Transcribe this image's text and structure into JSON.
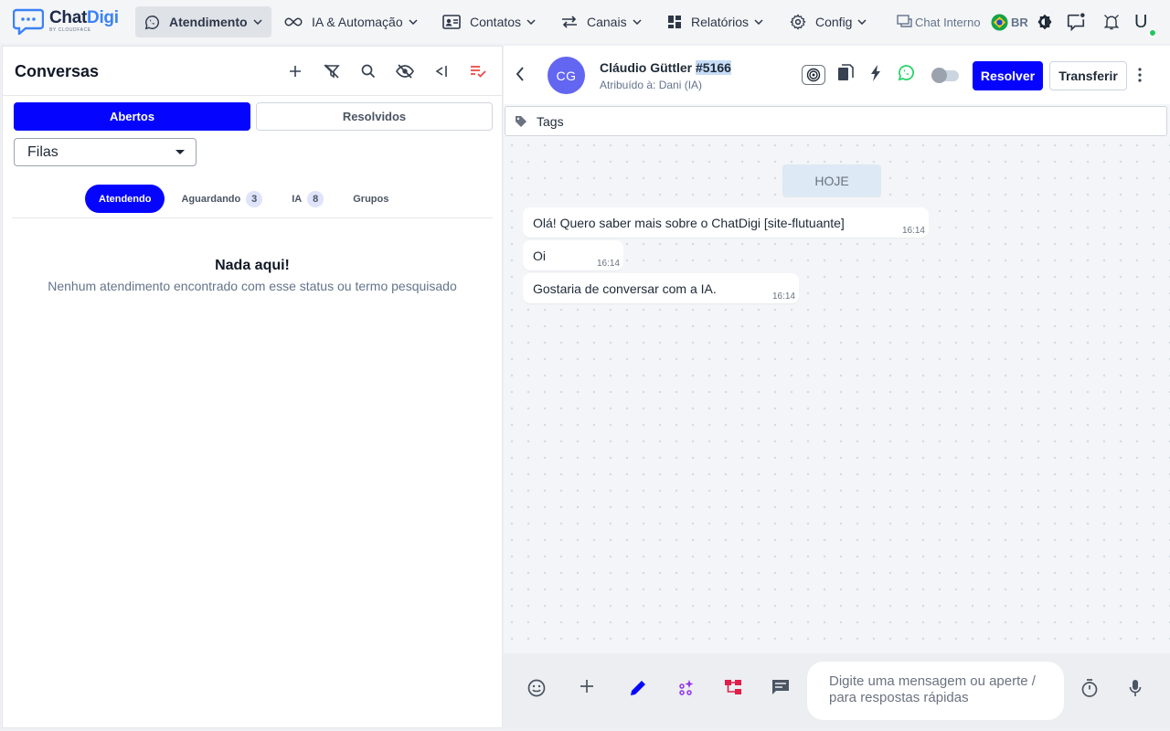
{
  "brand": {
    "name_main": "Chat",
    "name_accent": "Digi",
    "subtitle": "BY CLOUDFACE",
    "accent_color": "#3b82f6"
  },
  "nav": {
    "items": [
      {
        "label": "Atendimento",
        "icon": "whatsapp-icon",
        "active": true
      },
      {
        "label": "IA & Automação",
        "icon": "infinity-icon"
      },
      {
        "label": "Contatos",
        "icon": "contact-card-icon"
      },
      {
        "label": "Canais",
        "icon": "arrows-icon"
      },
      {
        "label": "Relatórios",
        "icon": "dashboard-icon"
      },
      {
        "label": "Config",
        "icon": "gear-icon"
      }
    ],
    "chat_interno": "Chat Interno",
    "lang": "BR",
    "user_initial": "U"
  },
  "left": {
    "title": "Conversas",
    "tabs": {
      "open": "Abertos",
      "resolved": "Resolvidos"
    },
    "queue_select": "Filas",
    "subtabs": [
      {
        "label": "Atendendo",
        "count": null
      },
      {
        "label": "Aguardando",
        "count": "3"
      },
      {
        "label": "IA",
        "count": "8"
      },
      {
        "label": "Grupos",
        "count": null
      }
    ],
    "empty_title": "Nada aqui!",
    "empty_sub": "Nenhum atendimento encontrado com esse status ou termo pesquisado"
  },
  "chat": {
    "avatar_initials": "CG",
    "contact_name": "Cláudio Güttler",
    "ticket_id": "#5166",
    "assigned": "Atribuído à: Dani (IA)",
    "resolve_label": "Resolver",
    "transfer_label": "Transferir",
    "tags_label": "Tags",
    "day_label": "HOJE",
    "messages": [
      {
        "text": "Olá! Quero saber mais sobre o ChatDigi [site-flutuante]",
        "time": "16:14"
      },
      {
        "text": "Oi",
        "time": "16:14"
      },
      {
        "text": "Gostaria de conversar com a IA.",
        "time": "16:14"
      }
    ],
    "input_placeholder": "Digite uma mensagem ou aperte / para respostas rápidas"
  },
  "colors": {
    "primary": "#0505ff",
    "avatar": "#6366f1",
    "whatsapp": "#25d366",
    "online": "#22c55e"
  }
}
